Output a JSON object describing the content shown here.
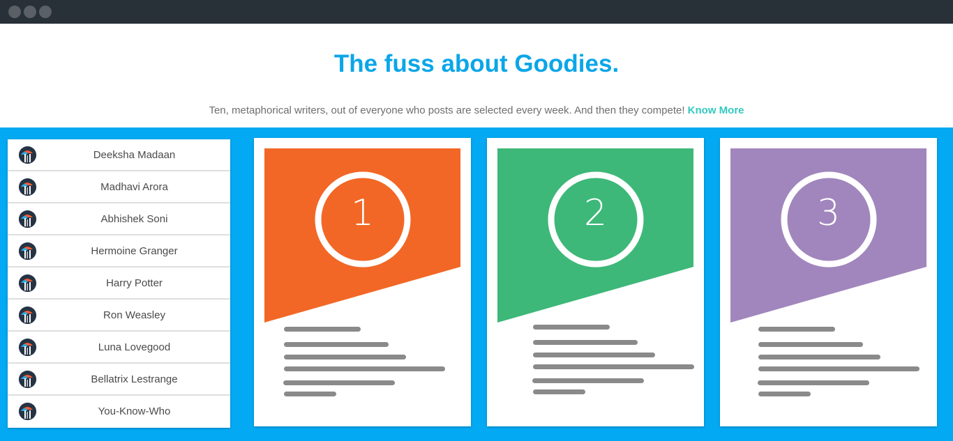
{
  "page": {
    "title": "The fuss about Goodies.",
    "subtitle": "Ten, metaphorical writers, out of everyone who posts are selected every week. And then they compete!",
    "link_label": "Know More"
  },
  "colors": {
    "accent": "#03a9f2",
    "title": "#0ba6e8",
    "link": "#32c9c0",
    "card_1": "#f26725",
    "card_2": "#3db878",
    "card_3": "#a186bd"
  },
  "writers": [
    {
      "name": "Deeksha Madaan",
      "icon": "avatar-icon"
    },
    {
      "name": "Madhavi Arora",
      "icon": "avatar-icon"
    },
    {
      "name": "Abhishek Soni",
      "icon": "avatar-icon"
    },
    {
      "name": "Hermoine Granger",
      "icon": "avatar-icon"
    },
    {
      "name": "Harry Potter",
      "icon": "avatar-icon"
    },
    {
      "name": "Ron Weasley",
      "icon": "avatar-icon"
    },
    {
      "name": "Luna Lovegood",
      "icon": "avatar-icon"
    },
    {
      "name": "Bellatrix Lestrange",
      "icon": "avatar-icon"
    },
    {
      "name": "You-Know-Who",
      "icon": "avatar-icon"
    }
  ],
  "cards": [
    {
      "rank": "1"
    },
    {
      "rank": "2"
    },
    {
      "rank": "3"
    }
  ]
}
